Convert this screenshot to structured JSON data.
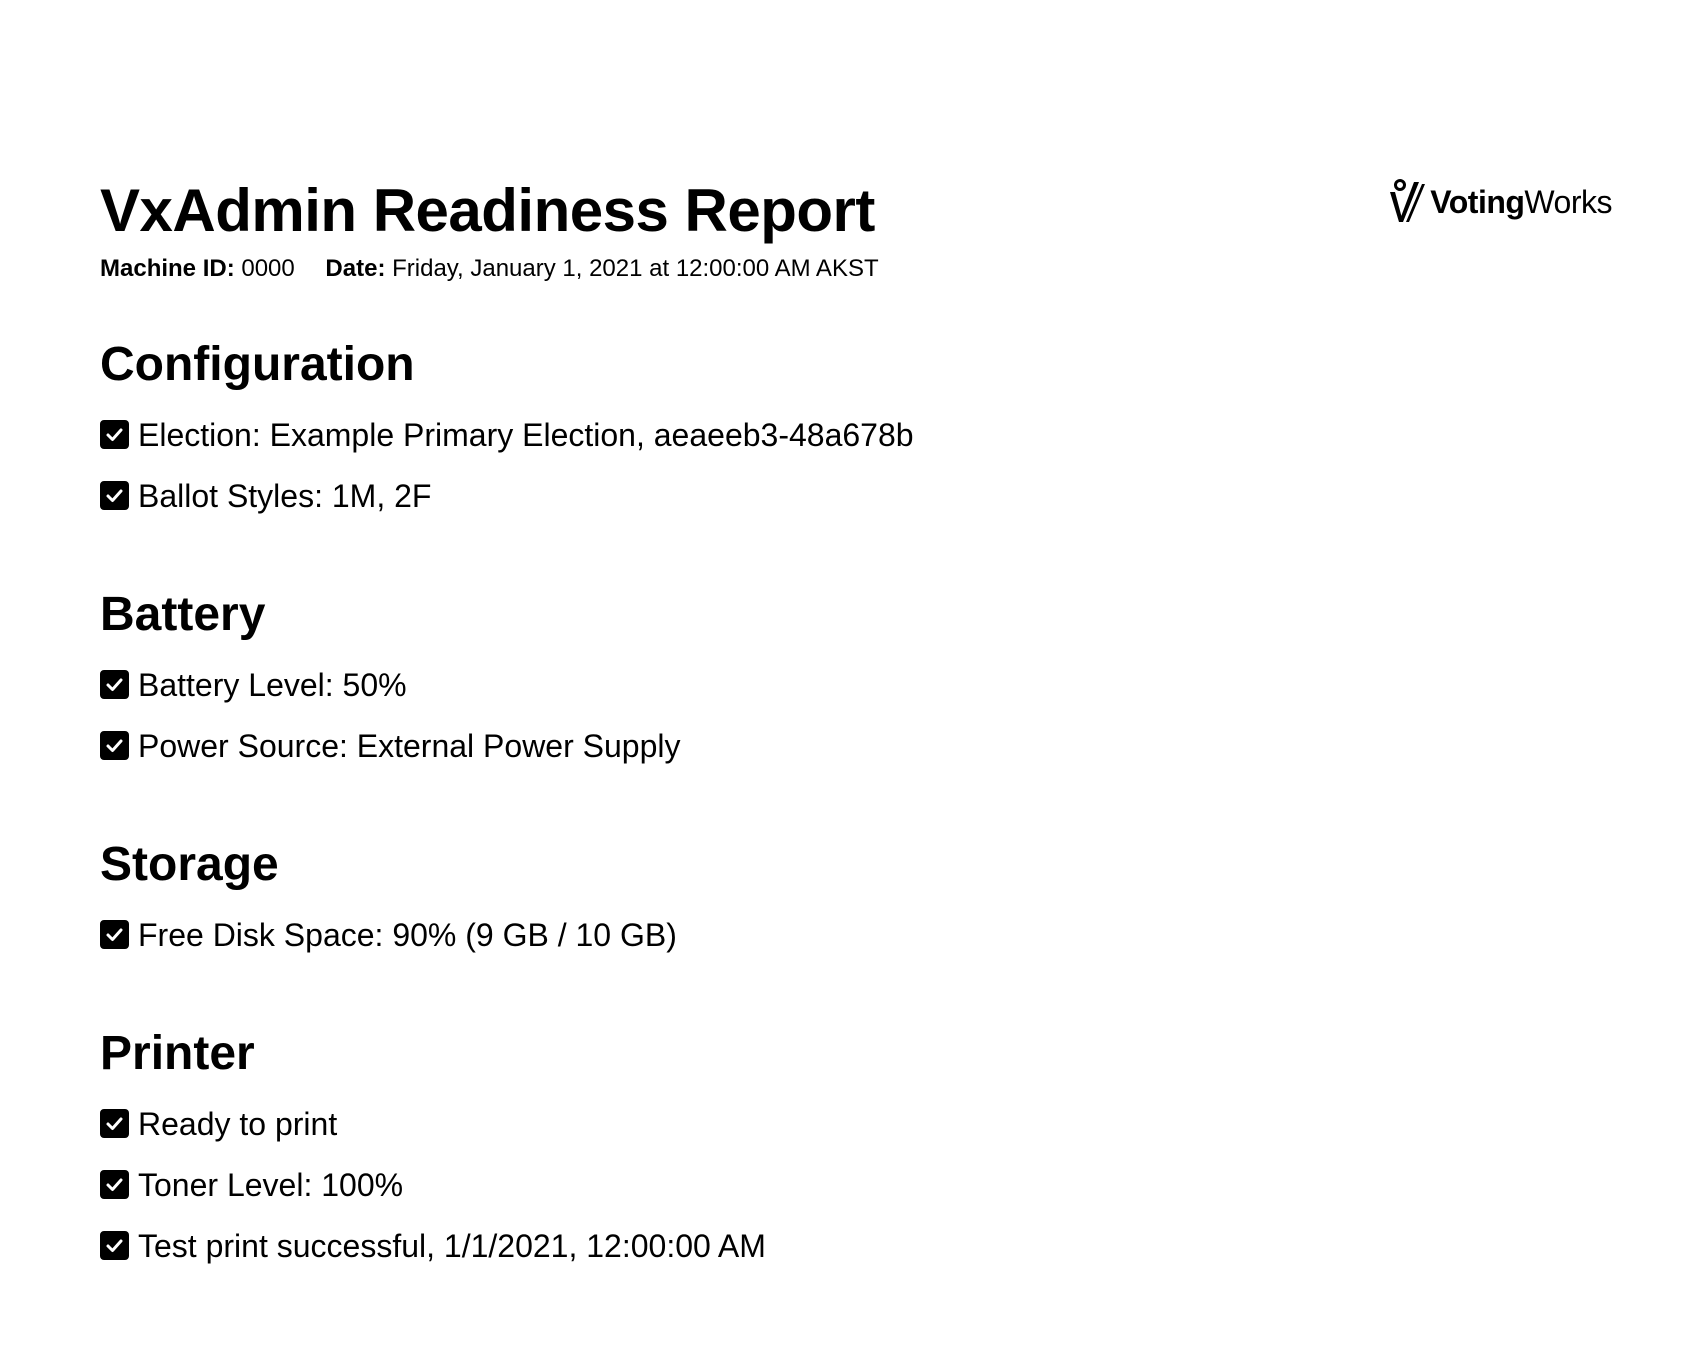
{
  "header": {
    "title": "VxAdmin Readiness Report",
    "machine_id_label": "Machine ID:",
    "machine_id_value": "0000",
    "date_label": "Date:",
    "date_value": "Friday, January 1, 2021 at 12:00:00 AM AKST"
  },
  "logo": {
    "icon": "votingworks-logo-icon",
    "text_bold": "Voting",
    "text_regular": "Works"
  },
  "sections": {
    "configuration": {
      "title": "Configuration",
      "items": [
        "Election: Example Primary Election, aeaeeb3-48a678b",
        "Ballot Styles: 1M, 2F"
      ]
    },
    "battery": {
      "title": "Battery",
      "items": [
        "Battery Level: 50%",
        "Power Source: External Power Supply"
      ]
    },
    "storage": {
      "title": "Storage",
      "items": [
        "Free Disk Space: 90% (9 GB / 10 GB)"
      ]
    },
    "printer": {
      "title": "Printer",
      "items": [
        "Ready to print",
        "Toner Level: 100%",
        "Test print successful, 1/1/2021, 12:00:00 AM"
      ]
    }
  },
  "icons": {
    "status": "checkbox-checked-icon"
  },
  "colors": {
    "text": "#000000",
    "background": "#ffffff",
    "check_fill": "#000000"
  }
}
